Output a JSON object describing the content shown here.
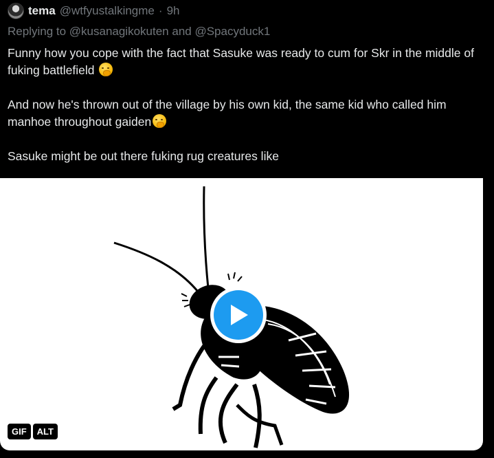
{
  "header": {
    "display_name": "tema",
    "handle": "@wtfyustalkingme",
    "separator": "·",
    "time": "9h",
    "avatar_icon": "avatar-image"
  },
  "reply": {
    "prefix": "Replying to ",
    "mention1": "@kusanagikokuten",
    "joiner": " and ",
    "mention2": "@Spacyduck1"
  },
  "tweet": {
    "paragraph1": "Funny how you cope with the fact that Sasuke was ready to cum for Skr in the middle of fuking battlefield",
    "paragraph2": "And now he's thrown out of the village by his own kid, the same kid who called him manhoe throughout gaiden",
    "paragraph3": "Sasuke might be out there fuking rug creatures like",
    "emoji_icon": "face-with-hand-over-mouth-emoji"
  },
  "media": {
    "type": "gif",
    "gif_label": "GIF",
    "alt_label": "ALT",
    "play_icon": "play-icon",
    "accent_color": "#1d9bf0"
  }
}
